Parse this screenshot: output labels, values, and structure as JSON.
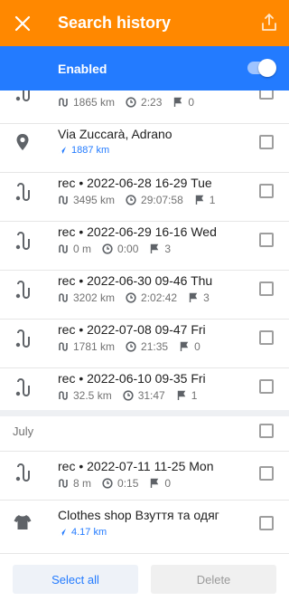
{
  "header": {
    "title": "Search history",
    "close_icon": "close-icon",
    "share_icon": "share-icon",
    "color": "#ff8800"
  },
  "enabled": {
    "label": "Enabled",
    "toggle_on": true,
    "color": "#237bff"
  },
  "items": [
    {
      "type": "track",
      "name": "",
      "distance": "1865 km",
      "time": "2:23",
      "points": "0"
    },
    {
      "type": "place",
      "name": "Via Zuccarà, Adrano",
      "distance": "1887 km"
    },
    {
      "type": "track",
      "name": "rec • 2022-06-28 16-29 Tue",
      "distance": "3495 km",
      "time": "29:07:58",
      "points": "1"
    },
    {
      "type": "track",
      "name": "rec • 2022-06-29 16-16 Wed",
      "distance": "0 m",
      "time": "0:00",
      "points": "3"
    },
    {
      "type": "track",
      "name": "rec • 2022-06-30 09-46 Thu",
      "distance": "3202 km",
      "time": "2:02:42",
      "points": "3"
    },
    {
      "type": "track",
      "name": "rec • 2022-07-08 09-47 Fri",
      "distance": "1781 km",
      "time": "21:35",
      "points": "0"
    },
    {
      "type": "track",
      "name": "rec • 2022-06-10 09-35 Fri",
      "distance": "32.5 km",
      "time": "31:47",
      "points": "1"
    },
    {
      "type": "section",
      "name": "July"
    },
    {
      "type": "track",
      "name": "rec • 2022-07-11 11-25 Mon",
      "distance": "8 m",
      "time": "0:15",
      "points": "0"
    },
    {
      "type": "shop",
      "name": "Clothes shop Взуття та одяг",
      "distance": "4.17 km"
    }
  ],
  "footer": {
    "select_all": "Select all",
    "delete": "Delete"
  }
}
